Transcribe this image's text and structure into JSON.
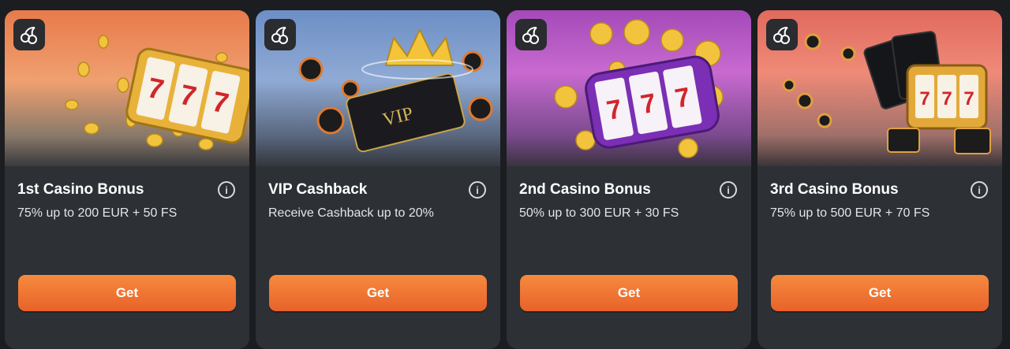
{
  "accent": "#ee7032",
  "cards": [
    {
      "title": "1st Casino Bonus",
      "description": "75% up to 200 EUR + 50 FS",
      "button": "Get",
      "banner": "slot-777-coins",
      "badge_icon": "cherries-icon",
      "info_icon": "info-icon",
      "info_glyph": "i"
    },
    {
      "title": "VIP Cashback",
      "description": "Receive Cashback up to 20%",
      "button": "Get",
      "banner": "vip-card-crown",
      "badge_icon": "cherries-icon",
      "info_icon": "info-icon",
      "info_glyph": "i"
    },
    {
      "title": "2nd Casino Bonus",
      "description": "50% up to 300 EUR + 30 FS",
      "button": "Get",
      "banner": "purple-slot-coins",
      "badge_icon": "cherries-icon",
      "info_icon": "info-icon",
      "info_glyph": "i"
    },
    {
      "title": "3rd Casino Bonus",
      "description": "75% up to 500 EUR + 70 FS",
      "button": "Get",
      "banner": "slot-cards-chips",
      "badge_icon": "cherries-icon",
      "info_icon": "info-icon",
      "info_glyph": "i"
    }
  ]
}
